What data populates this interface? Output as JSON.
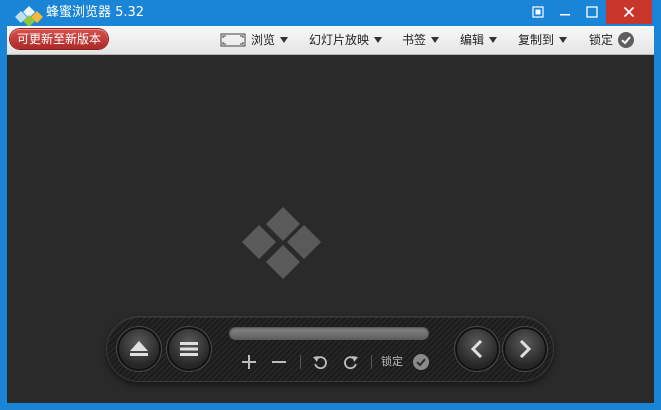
{
  "window": {
    "title": "蜂蜜浏览器 5.32",
    "icon": "app-logo-icon",
    "controls": [
      "pin-icon",
      "minimize-icon",
      "maximize-icon",
      "close-icon"
    ]
  },
  "toolbar": {
    "update_label": "可更新至新版本",
    "menus": [
      {
        "label": "浏览",
        "icon": "fullscreen-icon"
      },
      {
        "label": "幻灯片放映"
      },
      {
        "label": "书签"
      },
      {
        "label": "编辑"
      },
      {
        "label": "复制到"
      }
    ],
    "lock_label": "锁定"
  },
  "viewer": {
    "placeholder_icon": "app-logo-icon"
  },
  "controlbar": {
    "buttons": [
      "eject-icon",
      "menu-icon",
      "zoom-in-icon",
      "zoom-out-icon",
      "rotate-left-icon",
      "rotate-right-icon",
      "prev-icon",
      "next-icon"
    ],
    "lock_label": "锁定"
  },
  "colors": {
    "titlebar": "#1a85d6",
    "close": "#c7352b",
    "update_button": "#c03a37",
    "viewport": "#2a2a2a"
  }
}
